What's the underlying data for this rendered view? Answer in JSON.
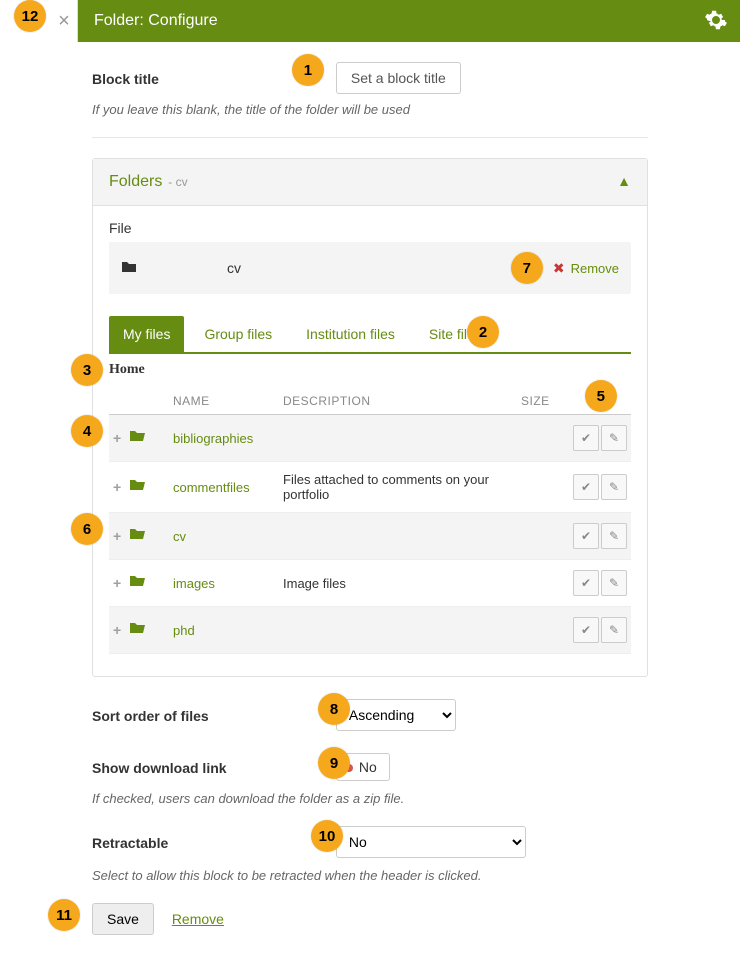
{
  "header": {
    "title": "Folder: Configure"
  },
  "block_title": {
    "label": "Block title",
    "button": "Set a block title",
    "help": "If you leave this blank, the title of the folder will be used"
  },
  "folders_panel": {
    "title": "Folders",
    "subtitle": "- cv",
    "file_label": "File",
    "selected_file": "cv",
    "remove_label": "Remove"
  },
  "tabs": {
    "my": "My files",
    "group": "Group files",
    "institution": "Institution files",
    "site": "Site files"
  },
  "breadcrumb": "Home",
  "columns": {
    "name": "NAME",
    "description": "DESCRIPTION",
    "size": "SIZE"
  },
  "rows": [
    {
      "name": "bibliographies",
      "description": ""
    },
    {
      "name": "commentfiles",
      "description": "Files attached to comments on your portfolio"
    },
    {
      "name": "cv",
      "description": ""
    },
    {
      "name": "images",
      "description": "Image files"
    },
    {
      "name": "phd",
      "description": ""
    }
  ],
  "sort": {
    "label": "Sort order of files",
    "value": "Ascending"
  },
  "download": {
    "label": "Show download link",
    "value": "No",
    "help": "If checked, users can download the folder as a zip file."
  },
  "retractable": {
    "label": "Retractable",
    "value": "No",
    "help": "Select to allow this block to be retracted when the header is clicked."
  },
  "actions": {
    "save": "Save",
    "remove": "Remove"
  },
  "badges": {
    "b1": "1",
    "b2": "2",
    "b3": "3",
    "b4": "4",
    "b5": "5",
    "b6": "6",
    "b7": "7",
    "b8": "8",
    "b9": "9",
    "b10": "10",
    "b11": "11",
    "b12": "12"
  }
}
